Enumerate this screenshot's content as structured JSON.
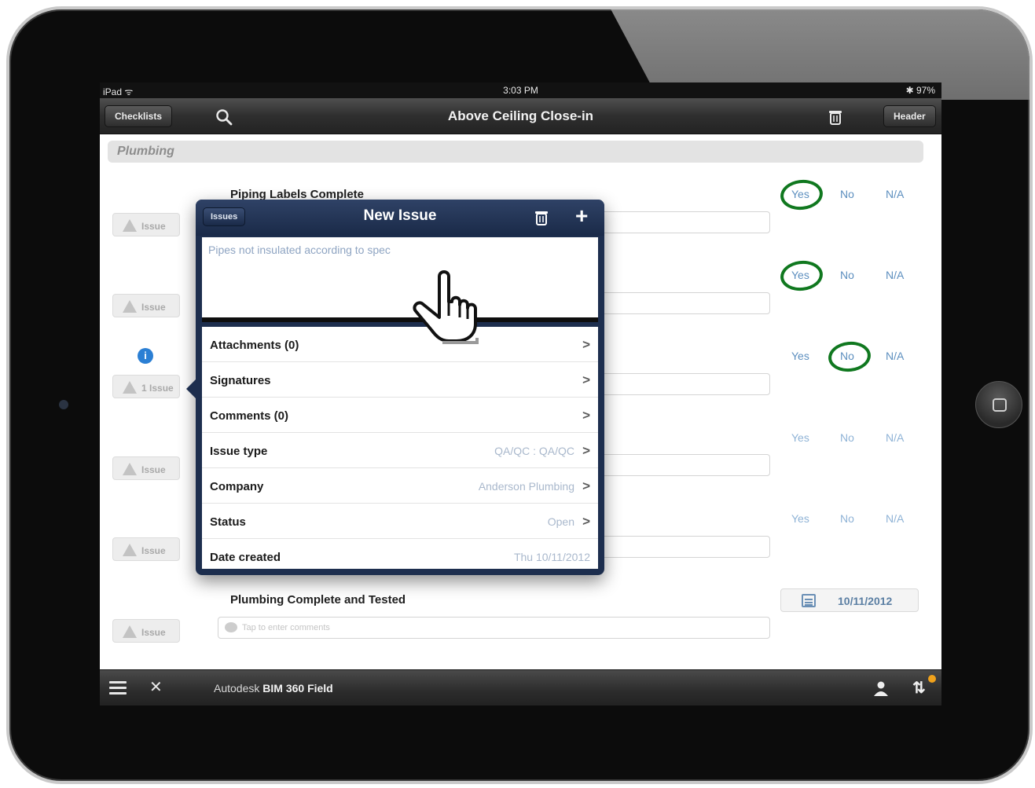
{
  "status_bar": {
    "left": "iPad ᯤ",
    "time": "3:03 PM",
    "right": "✱ 97%"
  },
  "nav": {
    "left_button": "Checklists",
    "title": "Above Ceiling Close-in",
    "right_button": "Header"
  },
  "section": {
    "title": "Plumbing"
  },
  "options": {
    "yes": "Yes",
    "no": "No",
    "na": "N/A"
  },
  "rows": [
    {
      "title": "Piping Labels Complete",
      "issue": "Issue",
      "selected": "Yes"
    },
    {
      "title": "",
      "issue": "Issue",
      "selected": "Yes"
    },
    {
      "title": "",
      "issue": "1 Issue",
      "selected": "No"
    },
    {
      "title": "",
      "issue": "Issue",
      "selected": ""
    },
    {
      "title": "",
      "issue": "Issue",
      "selected": ""
    },
    {
      "title": "Plumbing Complete and Tested",
      "issue": "Issue",
      "comment_placeholder": "Tap to enter comments",
      "date": "10/11/2012"
    }
  ],
  "popover": {
    "back_label": "Issues",
    "title": "New Issue",
    "plus": "+",
    "description": "Pipes not insulated according to spec",
    "fields": [
      {
        "label": "Attachments (0)",
        "value": ""
      },
      {
        "label": "Signatures",
        "value": ""
      },
      {
        "label": "Comments (0)",
        "value": ""
      },
      {
        "label": "Issue type",
        "value": "QA/QC : QA/QC"
      },
      {
        "label": "Company",
        "value": "Anderson Plumbing"
      },
      {
        "label": "Status",
        "value": "Open"
      },
      {
        "label": "Date created",
        "value": "Thu 10/11/2012"
      }
    ]
  },
  "toolbar": {
    "brand_prefix": "Autodesk",
    "brand_name": "BIM 360 Field"
  },
  "colors": {
    "accent_circle": "#10781f",
    "option_blue": "#5d8fbf",
    "popover_navy": "#1d2e4e"
  },
  "icons": [
    "search-icon",
    "trash-icon",
    "menu-icon",
    "tools-icon",
    "user-icon",
    "sync-icon",
    "calendar-icon",
    "warning-icon",
    "info-icon",
    "chevron-right-icon",
    "plus-icon",
    "hand-pointer-icon"
  ]
}
